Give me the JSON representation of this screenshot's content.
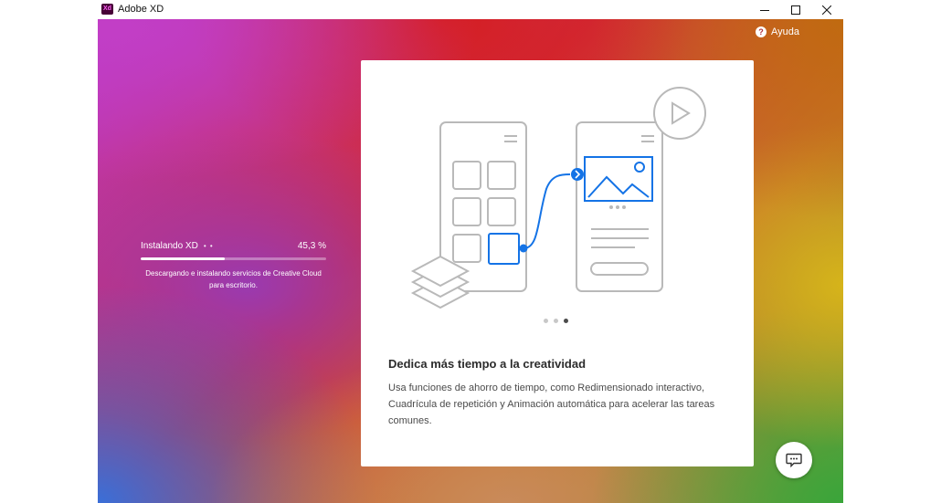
{
  "window": {
    "title": "Adobe XD",
    "app_logo_text": "Xd",
    "controls": {
      "minimize_icon": "minimize-icon",
      "maximize_icon": "maximize-icon",
      "close_icon": "close-icon"
    }
  },
  "header": {
    "help_label": "Ayuda",
    "help_icon": "question-circle-icon"
  },
  "install": {
    "label": "Instalando XD",
    "dots": "• •",
    "percent_text": "45,3 %",
    "progress": 0.453,
    "description": "Descargando e instalando servicios de Creative Cloud para escritorio."
  },
  "carousel": {
    "prev_label": "‹",
    "next_label": "›",
    "slide_count": 3,
    "active_slide": 3,
    "title": "Dedica más tiempo a la creatividad",
    "body": "Usa funciones de ahorro de tiempo, como Redimensionado interactivo, Cuadrícula de repetición y Animación automática para acelerar las tareas comunes."
  },
  "colors": {
    "accent_blue": "#1473e6",
    "xd_logo_bg": "#470137",
    "xd_logo_text": "#ff61f6",
    "illustration_gray": "#b9b9b9"
  },
  "chat": {
    "icon": "chat-bubble-icon"
  }
}
